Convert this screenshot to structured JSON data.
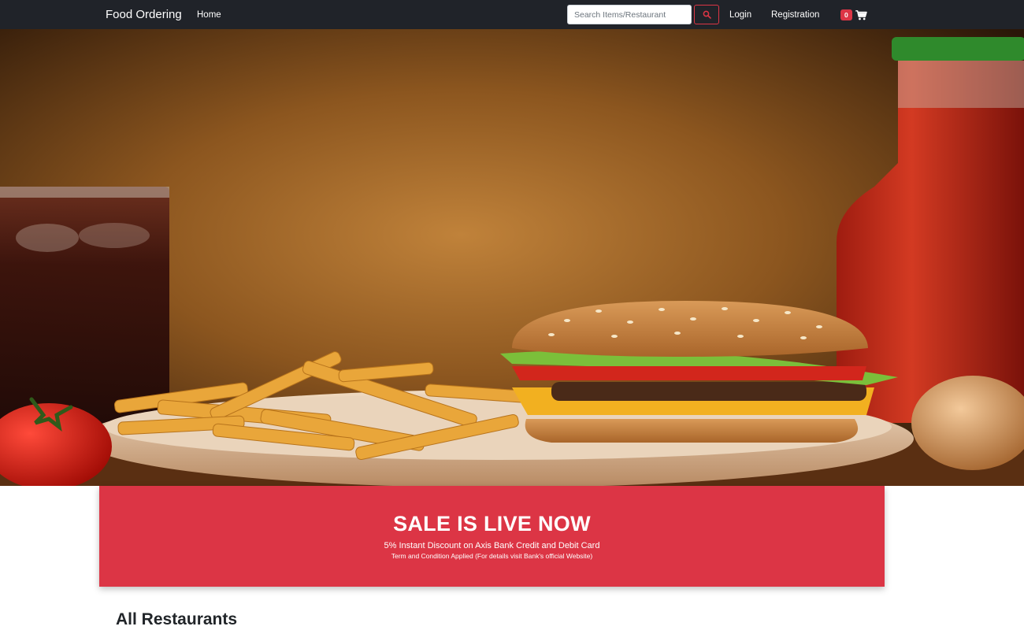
{
  "navbar": {
    "brand": "Food Ordering",
    "home": "Home",
    "search_placeholder": "Search Items/Restaurant",
    "login": "Login",
    "registration": "Registration",
    "cart_count": "0",
    "icons": {
      "search": "search-icon",
      "cart": "cart-icon"
    },
    "colors": {
      "background": "#202329",
      "accent": "#dc3545"
    }
  },
  "hero": {
    "image": "food-banner-image",
    "alt": "Burger, fries, cola and ketchup"
  },
  "sale": {
    "title": "SALE IS LIVE NOW",
    "subtitle": "5% Instant Discount on Axis Bank Credit and Debit Card",
    "note": "Term and Condition Applied (For details visit Bank's official Website)",
    "color": "#dc3545"
  },
  "section": {
    "title": "All Restaurants"
  }
}
